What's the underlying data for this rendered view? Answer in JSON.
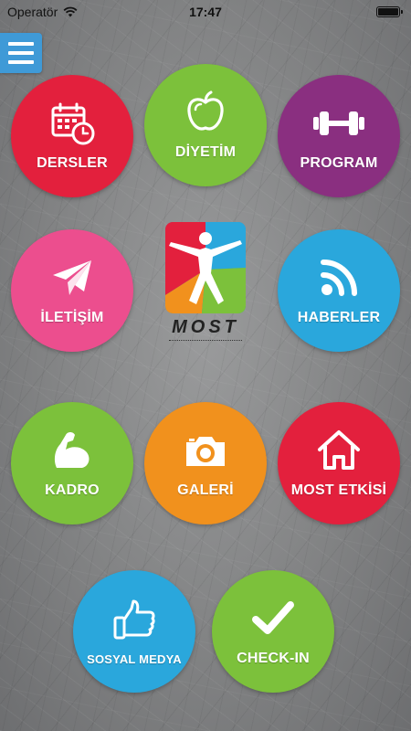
{
  "status_bar": {
    "carrier": "Operatör",
    "time": "17:47"
  },
  "menu": {
    "icon": "hamburger-icon",
    "color": "#3f9ad7"
  },
  "logo": {
    "wordmark": "MOST"
  },
  "tiles": [
    {
      "id": "dersler",
      "label": "DERSLER",
      "icon": "calendar-clock-icon",
      "color": "#e3203d"
    },
    {
      "id": "diyetim",
      "label": "DİYETİM",
      "icon": "apple-icon",
      "color": "#7cc13b"
    },
    {
      "id": "program",
      "label": "PROGRAM",
      "icon": "dumbbell-icon",
      "color": "#8a2f80"
    },
    {
      "id": "iletisim",
      "label": "İLETİŞİM",
      "icon": "paper-plane-icon",
      "color": "#ec4e8e"
    },
    {
      "id": "haberler",
      "label": "HABERLER",
      "icon": "wifi-feed-icon",
      "color": "#2aa7dc"
    },
    {
      "id": "kadro",
      "label": "KADRO",
      "icon": "flexed-arm-icon",
      "color": "#7cc13b"
    },
    {
      "id": "galeri",
      "label": "GALERİ",
      "icon": "camera-icon",
      "color": "#f1911d"
    },
    {
      "id": "most_etkisi",
      "label": "MOST ETKİSİ",
      "icon": "home-icon",
      "color": "#e3203d"
    },
    {
      "id": "sosyal_medya",
      "label": "SOSYAL MEDYA",
      "icon": "thumbs-up-icon",
      "color": "#2aa7dc"
    },
    {
      "id": "check_in",
      "label": "CHECK-IN",
      "icon": "checkmark-icon",
      "color": "#7cc13b"
    }
  ]
}
